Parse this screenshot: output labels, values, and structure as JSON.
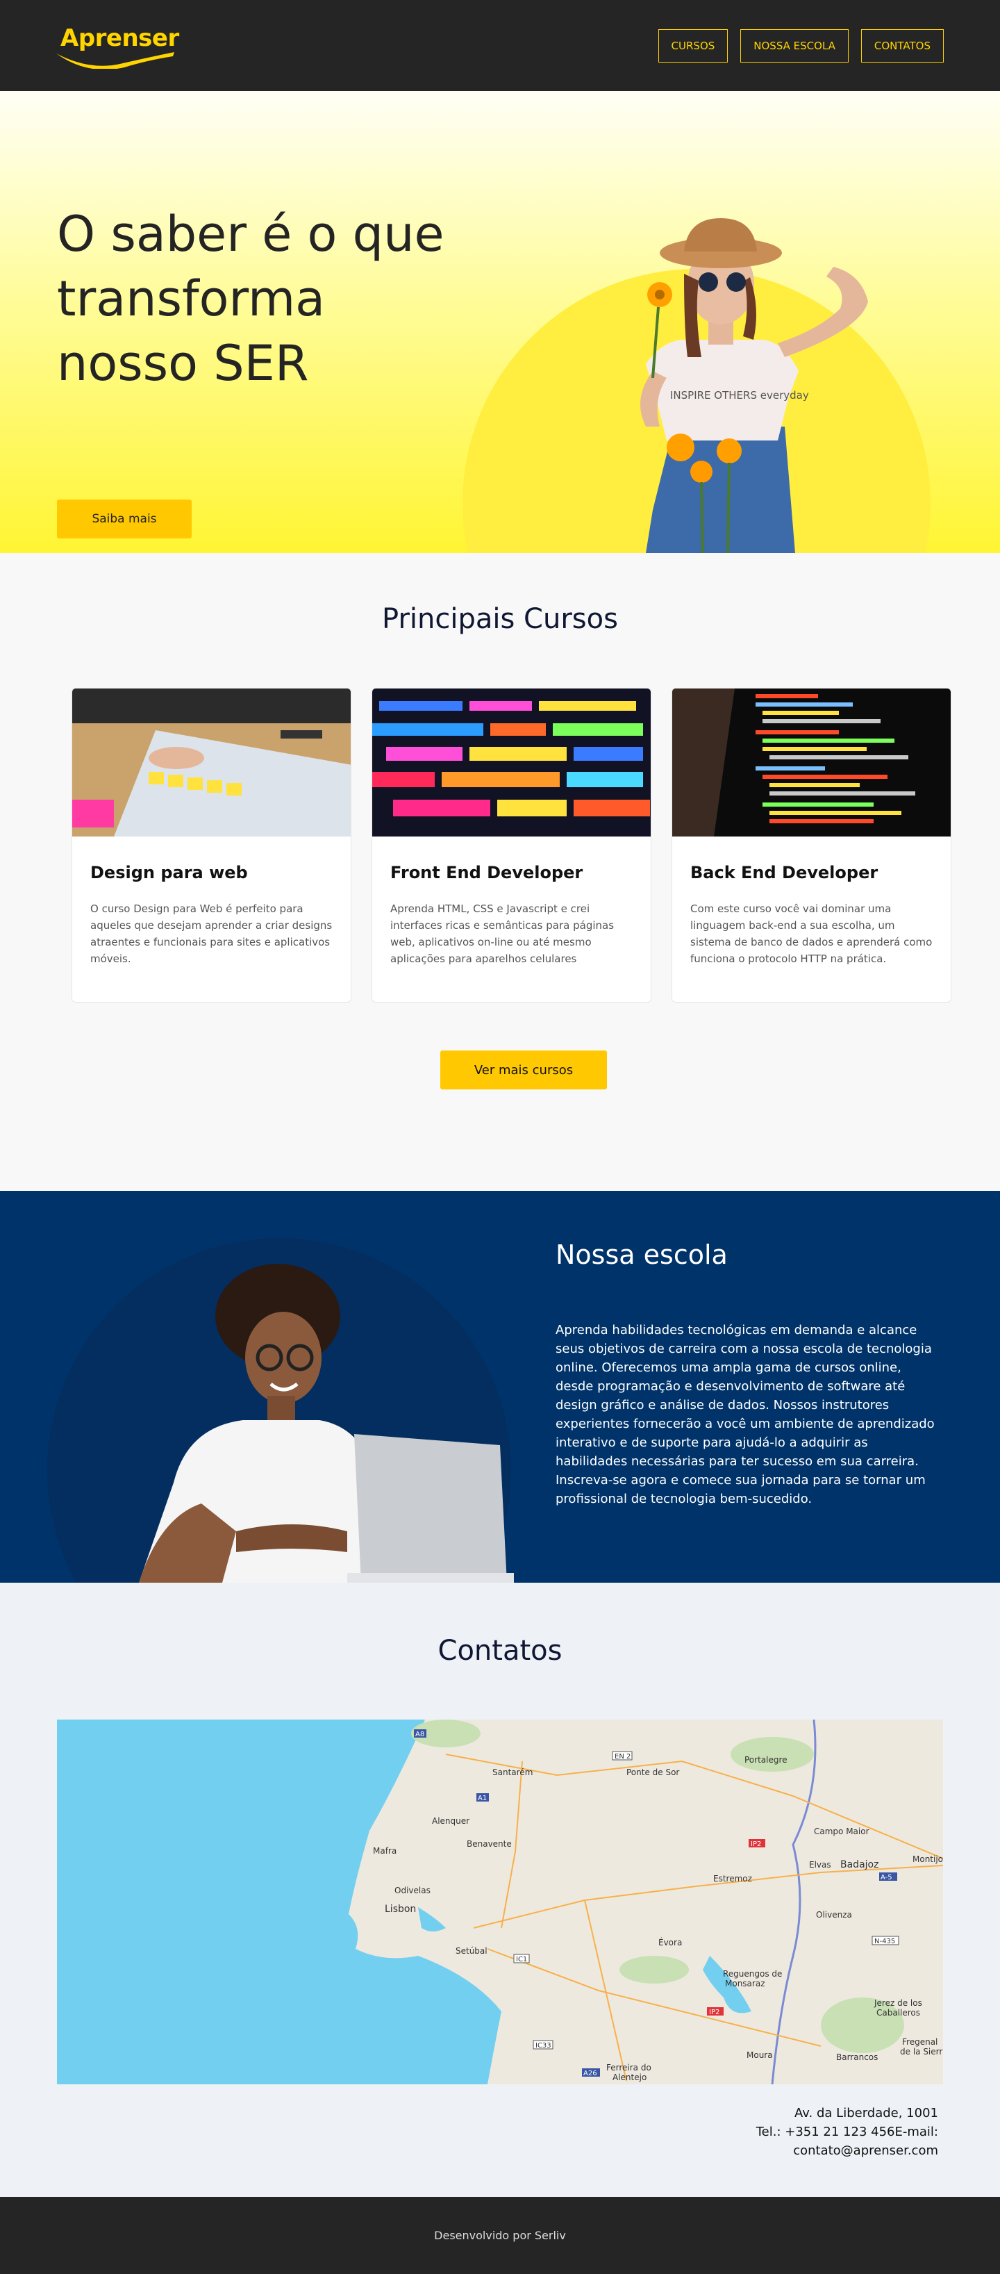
{
  "header": {
    "logo": "Aprenser",
    "nav": [
      {
        "label": "CURSOS"
      },
      {
        "label": "NOSSA ESCOLA"
      },
      {
        "label": "CONTATOS"
      }
    ]
  },
  "hero": {
    "title": "O saber é o que transforma nosso SER",
    "cta": "Saiba mais",
    "tshirt_text": "INSPIRE OTHERS everyday"
  },
  "courses": {
    "title": "Principais Cursos",
    "items": [
      {
        "title": "Design para web",
        "text": "O curso Design para Web é perfeito para aqueles que desejam aprender a criar designs atraentes e funcionais para sites e aplicativos móveis."
      },
      {
        "title": "Front End Developer",
        "text": "Aprenda HTML, CSS e Javascript e crei interfaces ricas e semânticas para páginas web, aplicativos on-line ou até mesmo aplicações para aparelhos celulares"
      },
      {
        "title": "Back End Developer",
        "text": "Com este curso você vai dominar uma linguagem back-end a sua escolha, um sistema de banco de dados e aprenderá como funciona o protocolo HTTP na prática."
      }
    ],
    "more": "Ver mais cursos"
  },
  "school": {
    "title": "Nossa escola",
    "text": "Aprenda habilidades tecnológicas em demanda e alcance seus objetivos de carreira com a nossa escola de tecnologia online. Oferecemos uma ampla gama de cursos online, desde programação e desenvolvimento de software até design gráfico e análise de dados. Nossos instrutores experientes fornecerão a você um ambiente de aprendizado interativo e de suporte para ajudá-lo a adquirir as habilidades necessárias para ter sucesso em sua carreira. Inscreva-se agora e comece sua jornada para se tornar um profissional de tecnologia bem-sucedido."
  },
  "contacts": {
    "title": "Contatos",
    "address_line1": "Av. da Liberdade, 1001",
    "address_line2": "Tel.: +351 21 123 456E-mail:",
    "address_line3": "contato@aprenser.com",
    "map": {
      "places": [
        "Santarém",
        "Ponte de Sor",
        "Portalegre",
        "Alenquer",
        "Benavente",
        "Mafra",
        "Odivelas",
        "Lisbon",
        "Setúbal",
        "Estremoz",
        "Elvas",
        "Badajoz",
        "Campo Maior",
        "Montijo",
        "Olivenza",
        "Évora",
        "Reguengos de Monsaraz",
        "Jerez de los Caballeros",
        "Fregenal de la Sierra",
        "Moura",
        "Barrancos",
        "Ferreira do Alentejo"
      ],
      "roads": [
        "A8",
        "A1",
        "EN 2",
        "IP2",
        "A-5",
        "N-435",
        "IC1",
        "IC33",
        "A26"
      ]
    }
  },
  "footer": {
    "text": "Desenvolvido por Serliv"
  },
  "colors": {
    "accent": "#ffc800",
    "dark": "#252525",
    "navy": "#00336a"
  }
}
